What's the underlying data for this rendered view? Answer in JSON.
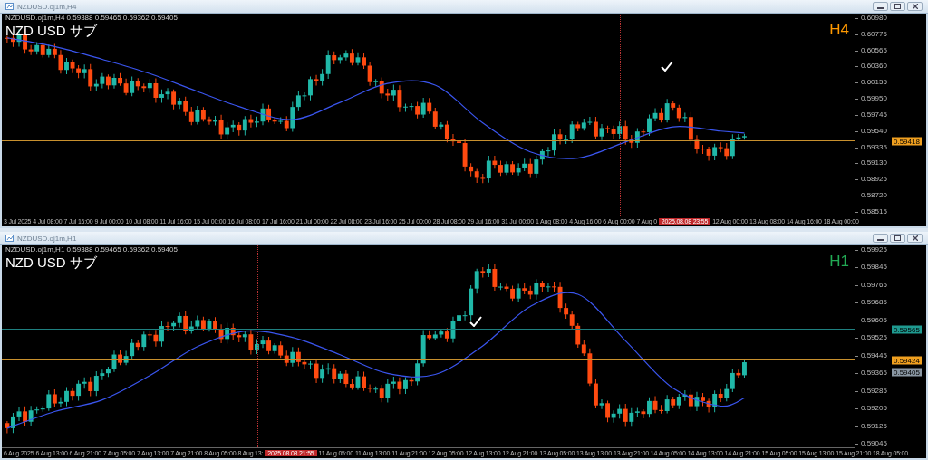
{
  "windows": [
    {
      "title": "NZDUSD.oj1m,H4",
      "header": "NZDUSD.oj1m,H4  0.59388 0.59465 0.59362 0.59405",
      "label": "NZD USD サブ",
      "timeframe": "H4",
      "color": "#ff9900",
      "price_ticks": [
        "0.60980",
        "0.60775",
        "0.60565",
        "0.60360",
        "0.60155",
        "0.59950",
        "0.59745",
        "0.59540",
        "0.59335",
        "0.59130",
        "0.58925",
        "0.58720",
        "0.58515"
      ],
      "price_tags": [
        {
          "text": "0.59418",
          "kind": "bid"
        }
      ],
      "time_ticks": [
        {
          "text": "3 Jul 2025",
          "kind": "tick"
        },
        {
          "text": "4 Jul 08:00",
          "kind": "tick"
        },
        {
          "text": "7 Jul 16:00",
          "kind": "tick"
        },
        {
          "text": "9 Jul 00:00",
          "kind": "tick"
        },
        {
          "text": "10 Jul 08:00",
          "kind": "tick"
        },
        {
          "text": "11 Jul 16:00",
          "kind": "tick"
        },
        {
          "text": "15 Jul 00:00",
          "kind": "tick"
        },
        {
          "text": "16 Jul 08:00",
          "kind": "tick"
        },
        {
          "text": "17 Jul 16:00",
          "kind": "tick"
        },
        {
          "text": "21 Jul 00:00",
          "kind": "tick"
        },
        {
          "text": "22 Jul 08:00",
          "kind": "tick"
        },
        {
          "text": "23 Jul 16:00",
          "kind": "tick"
        },
        {
          "text": "25 Jul 00:00",
          "kind": "tick"
        },
        {
          "text": "28 Jul 08:00",
          "kind": "tick"
        },
        {
          "text": "29 Jul 16:00",
          "kind": "tick"
        },
        {
          "text": "31 Jul 00:00",
          "kind": "tick"
        },
        {
          "text": "1 Aug 08:00",
          "kind": "tick"
        },
        {
          "text": "4 Aug 16:00",
          "kind": "tick"
        },
        {
          "text": "6 Aug 00:00",
          "kind": "tick"
        },
        {
          "text": "7 Aug 0",
          "kind": "tick"
        },
        {
          "text": "2025.08.08 23:55",
          "kind": "crosshair"
        },
        {
          "text": "12 Aug 00:00",
          "kind": "tick"
        },
        {
          "text": "13 Aug 08:00",
          "kind": "tick"
        },
        {
          "text": "14 Aug 16:00",
          "kind": "tick"
        },
        {
          "text": "18 Aug 00:00",
          "kind": "tick"
        }
      ]
    },
    {
      "title": "NZDUSD.oj1m,H1",
      "header": "NZDUSD.oj1m,H1  0.59388 0.59465 0.59362 0.59405",
      "label": "NZD USD サブ",
      "timeframe": "H1",
      "color": "#22aa55",
      "price_ticks": [
        "0.59925",
        "0.59845",
        "0.59765",
        "0.59685",
        "0.59605",
        "0.59525",
        "0.59445",
        "0.59365",
        "0.59285",
        "0.59205",
        "0.59125",
        "0.59045"
      ],
      "price_tags": [
        {
          "text": "0.59565",
          "kind": "line"
        },
        {
          "text": "0.59424",
          "kind": "bid"
        },
        {
          "text": "0.59405",
          "kind": "ask"
        }
      ],
      "time_ticks": [
        {
          "text": "6 Aug 2025",
          "kind": "tick"
        },
        {
          "text": "6 Aug 13:00",
          "kind": "tick"
        },
        {
          "text": "6 Aug 21:00",
          "kind": "tick"
        },
        {
          "text": "7 Aug 05:00",
          "kind": "tick"
        },
        {
          "text": "7 Aug 13:00",
          "kind": "tick"
        },
        {
          "text": "7 Aug 21:00",
          "kind": "tick"
        },
        {
          "text": "8 Aug 05:00",
          "kind": "tick"
        },
        {
          "text": "8 Aug 13:",
          "kind": "tick"
        },
        {
          "text": "2025.08.08 21:55",
          "kind": "crosshair"
        },
        {
          "text": "11 Aug 05:00",
          "kind": "tick"
        },
        {
          "text": "11 Aug 13:00",
          "kind": "tick"
        },
        {
          "text": "11 Aug 21:00",
          "kind": "tick"
        },
        {
          "text": "12 Aug 05:00",
          "kind": "tick"
        },
        {
          "text": "12 Aug 13:00",
          "kind": "tick"
        },
        {
          "text": "12 Aug 21:00",
          "kind": "tick"
        },
        {
          "text": "13 Aug 05:00",
          "kind": "tick"
        },
        {
          "text": "13 Aug 13:00",
          "kind": "tick"
        },
        {
          "text": "13 Aug 21:00",
          "kind": "tick"
        },
        {
          "text": "14 Aug 05:00",
          "kind": "tick"
        },
        {
          "text": "14 Aug 13:00",
          "kind": "tick"
        },
        {
          "text": "14 Aug 21:00",
          "kind": "tick"
        },
        {
          "text": "15 Aug 05:00",
          "kind": "tick"
        },
        {
          "text": "15 Aug 13:00",
          "kind": "tick"
        },
        {
          "text": "15 Aug 21:00",
          "kind": "tick"
        },
        {
          "text": "18 Aug 05:00",
          "kind": "tick"
        }
      ]
    }
  ]
}
